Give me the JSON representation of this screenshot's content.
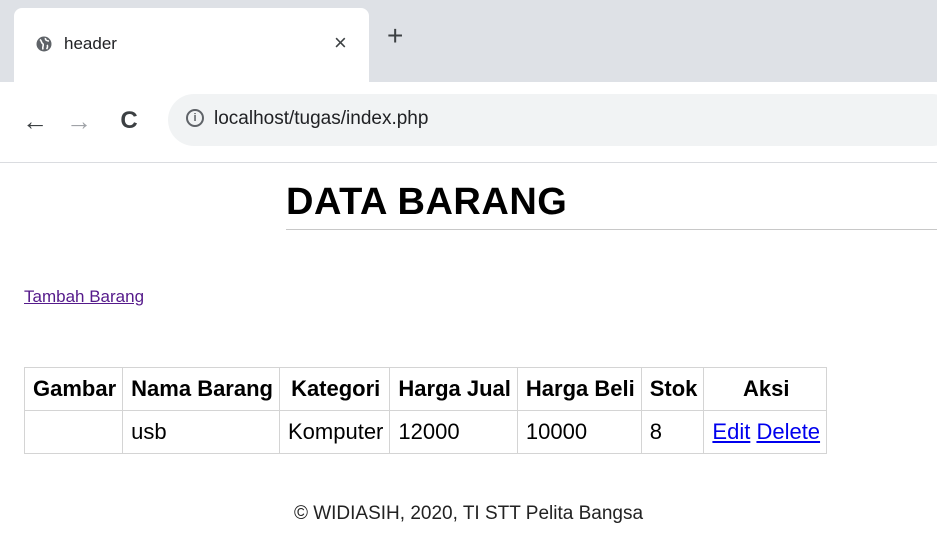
{
  "browser": {
    "tab_title": "header",
    "close_glyph": "×",
    "new_tab_glyph": "+",
    "back_glyph": "←",
    "forward_glyph": "→",
    "reload_glyph": "C",
    "info_glyph": "i",
    "url": "localhost/tugas/index.php"
  },
  "page": {
    "title": "DATA BARANG",
    "add_link": "Tambah Barang",
    "table": {
      "headers": [
        "Gambar",
        "Nama Barang",
        "Kategori",
        "Harga Jual",
        "Harga Beli",
        "Stok",
        "Aksi"
      ],
      "rows": [
        {
          "gambar": "",
          "nama_barang": "usb",
          "kategori": "Komputer",
          "harga_jual": "12000",
          "harga_beli": "10000",
          "stok": "8",
          "edit_label": "Edit",
          "delete_label": "Delete"
        }
      ]
    },
    "footer": "© WIDIASIH, 2020, TI STT Pelita Bangsa"
  },
  "colors": {
    "link_visited": "#551a8b",
    "link": "#0000ee",
    "chrome_bg": "#dee1e6",
    "omnibox_bg": "#f1f3f4"
  }
}
